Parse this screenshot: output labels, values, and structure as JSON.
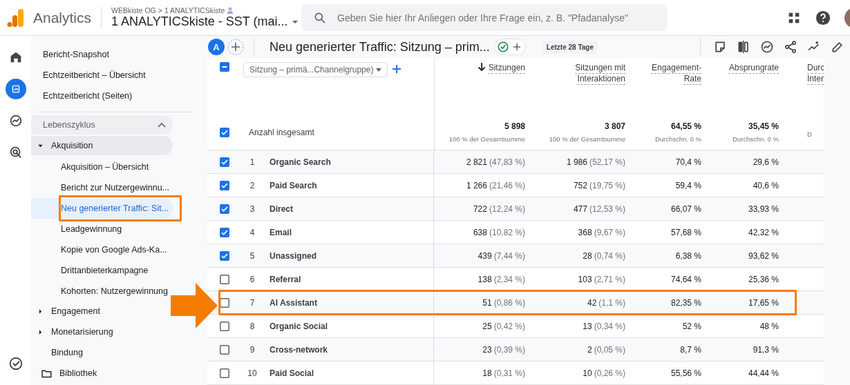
{
  "header": {
    "product": "Analytics",
    "account": "WEBkiste OG",
    "separator": ">",
    "property": "1 ANALYTICSkiste",
    "property_title": "1 ANALYTICSkiste - SST (mai...",
    "search": {
      "placeholder": "Geben Sie hier Ihr Anliegen oder Ihre Frage ein, z. B. \"Pfadanalyse\""
    }
  },
  "rail": [
    {
      "kind": "home",
      "selected": false
    },
    {
      "kind": "reports",
      "selected": true
    },
    {
      "kind": "explore",
      "selected": false
    },
    {
      "kind": "advertising",
      "selected": false
    }
  ],
  "sidebar": {
    "top_items": [
      "Bericht-Snapshot",
      "Echtzeitbericht – Übersicht",
      "Echtzeitbericht (Seiten)"
    ],
    "section": {
      "label": "Lebenszyklus",
      "expanded": true
    },
    "groups": [
      {
        "kind": "group",
        "label": "Akquisition",
        "expanded": true,
        "children": [
          {
            "label": "Akquisition – Übersicht",
            "selected": false,
            "highlighted": false
          },
          {
            "label": "Bericht zur Nutzergewinnu...",
            "selected": false,
            "highlighted": false
          },
          {
            "label": "Neu generierter Traffic: Sit...",
            "selected": true,
            "highlighted": true
          },
          {
            "label": "Leadgewinnung",
            "selected": false,
            "highlighted": false
          },
          {
            "label": "Kopie von Google Ads-Ka...",
            "selected": false,
            "highlighted": false
          },
          {
            "label": "Drittanbieterkampagne",
            "selected": false,
            "highlighted": false
          },
          {
            "label": "Kohorten: Nutzergewinnung",
            "selected": false,
            "highlighted": false
          }
        ]
      },
      {
        "kind": "group",
        "label": "Engagement",
        "expanded": false
      },
      {
        "kind": "group",
        "label": "Monetarisierung",
        "expanded": false
      },
      {
        "kind": "item",
        "label": "Bindung"
      },
      {
        "kind": "library",
        "label": "Bibliothek"
      }
    ]
  },
  "report": {
    "avatar": "A",
    "title": "Neu generierter Traffic: Sitzung – prim...",
    "date_range": "Letzte 28 Tage"
  },
  "table": {
    "header_indeterminate": true,
    "dimension": "Sitzung – primä...Channelgruppe)",
    "columns": [
      {
        "label": "Sitzungen",
        "sorted": true
      },
      {
        "label": "Sitzungen mit Interaktionen",
        "sorted": false
      },
      {
        "label": "Engagement-Rate",
        "sorted": false
      },
      {
        "label": "Absprungrate",
        "sorted": false
      },
      {
        "label": "Durc Inter",
        "sorted": false
      }
    ],
    "totals": {
      "checked": true,
      "label": "Anzahl insgesamt",
      "values": [
        {
          "value": "5 898",
          "note": "100 % der Gesamtsumme"
        },
        {
          "value": "3 807",
          "note": "100 % der Gesamtsumme"
        },
        {
          "value": "64,55 %",
          "note": "Durchschn. 0 %"
        },
        {
          "value": "35,45 %",
          "note": "Durchschn. 0 %"
        },
        {
          "note": "D"
        }
      ]
    },
    "rows": [
      {
        "index": "1",
        "name": "Organic Search",
        "checked": true,
        "highlighted": false,
        "sessions": "2 821",
        "sessions_share": "(47,83 %)",
        "engaged": "1 986",
        "engaged_share": "(52,17 %)",
        "engagement_rate": "70,4 %",
        "bounce_rate": "29,6 %"
      },
      {
        "index": "2",
        "name": "Paid Search",
        "checked": true,
        "highlighted": false,
        "sessions": "1 266",
        "sessions_share": "(21,46 %)",
        "engaged": "752",
        "engaged_share": "(19,75 %)",
        "engagement_rate": "59,4 %",
        "bounce_rate": "40,6 %"
      },
      {
        "index": "3",
        "name": "Direct",
        "checked": true,
        "highlighted": false,
        "sessions": "722",
        "sessions_share": "(12,24 %)",
        "engaged": "477",
        "engaged_share": "(12,53 %)",
        "engagement_rate": "66,07 %",
        "bounce_rate": "33,93 %"
      },
      {
        "index": "4",
        "name": "Email",
        "checked": true,
        "highlighted": false,
        "sessions": "638",
        "sessions_share": "(10,82 %)",
        "engaged": "368",
        "engaged_share": "(9,67 %)",
        "engagement_rate": "57,68 %",
        "bounce_rate": "42,32 %"
      },
      {
        "index": "5",
        "name": "Unassigned",
        "checked": true,
        "highlighted": false,
        "sessions": "439",
        "sessions_share": "(7,44 %)",
        "engaged": "28",
        "engaged_share": "(0,74 %)",
        "engagement_rate": "6,38 %",
        "bounce_rate": "93,62 %"
      },
      {
        "index": "6",
        "name": "Referral",
        "checked": false,
        "highlighted": false,
        "sessions": "138",
        "sessions_share": "(2,34 %)",
        "engaged": "103",
        "engaged_share": "(2,71 %)",
        "engagement_rate": "74,64 %",
        "bounce_rate": "25,36 %"
      },
      {
        "index": "7",
        "name": "AI Assistant",
        "checked": false,
        "highlighted": true,
        "sessions": "51",
        "sessions_share": "(0,86 %)",
        "engaged": "42",
        "engaged_share": "(1,1 %)",
        "engagement_rate": "82,35 %",
        "bounce_rate": "17,65 %"
      },
      {
        "index": "8",
        "name": "Organic Social",
        "checked": false,
        "highlighted": false,
        "sessions": "25",
        "sessions_share": "(0,42 %)",
        "engaged": "13",
        "engaged_share": "(0,34 %)",
        "engagement_rate": "52 %",
        "bounce_rate": "48 %"
      },
      {
        "index": "9",
        "name": "Cross-network",
        "checked": false,
        "highlighted": false,
        "sessions": "23",
        "sessions_share": "(0,39 %)",
        "engaged": "2",
        "engaged_share": "(0,05 %)",
        "engagement_rate": "8,7 %",
        "bounce_rate": "91,3 %"
      },
      {
        "index": "10",
        "name": "Paid Social",
        "checked": false,
        "highlighted": false,
        "sessions": "18",
        "sessions_share": "(0,31 %)",
        "engaged": "10",
        "engaged_share": "(0,26 %)",
        "engagement_rate": "55,56 %",
        "bounce_rate": "44,44 %"
      }
    ]
  }
}
